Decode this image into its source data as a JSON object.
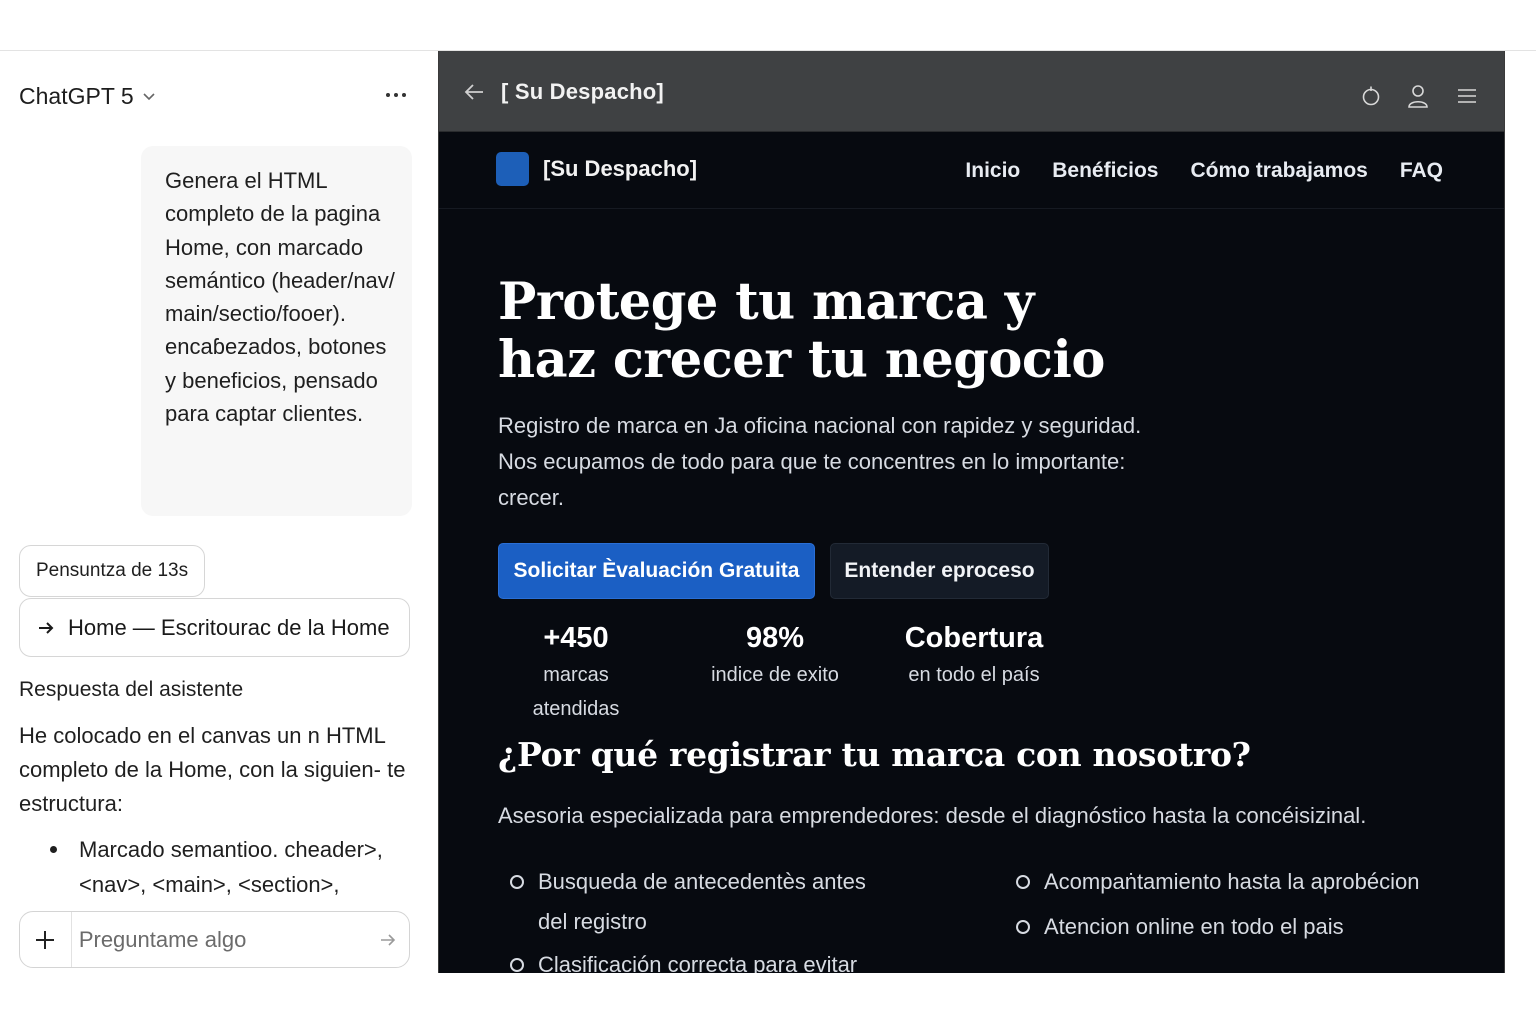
{
  "chat": {
    "model_name": "ChatGPT 5",
    "user_message": "Genera el HTML completo de la pagina Home, con marcado semántico (header/nav/ main/sectio/fooer). encaɓezados, botones y beneficios, pensado para captar clientes.",
    "thinking_label": "Pensuntza de 13s",
    "canvas_link": "Home — Escritourac de la Home",
    "response_label": "Respuesta del asistente",
    "response_text": "He colocado en el canvas un n HTML completo de la Home, con la siguien- te estructura:",
    "response_bullets": [
      "Marcado semantioo. cheader>, <nav>, <main>, <section>,"
    ],
    "composer_placeholder": "Preguntame algo"
  },
  "canvas": {
    "title": "[  Su Despacho]",
    "site": {
      "logo_text": "[Su Despacho]",
      "nav": [
        "Inicio",
        "Benéficios",
        "Cómo trabajamos",
        "FAQ"
      ],
      "hero_title_line1": "Protege tu marca y",
      "hero_title_line2": "haz crecer tu negocio",
      "hero_subtitle": "Registro de marca en Ja oficina nacional con rapidez y seguridad. Nos ecupamos de todo para que te concentres en lo importante: crecer.",
      "cta_primary": "Solicitar Èvaluación Gratuita",
      "cta_secondary": "Entender eproceso",
      "stats": [
        {
          "value": "+450",
          "label": "marcas atendidas"
        },
        {
          "value": "98%",
          "label": "indice de exito"
        },
        {
          "value": "Cobertura",
          "label": "en todo el país"
        }
      ],
      "why_title": "¿Por qué registrar tu marca con nosotro?",
      "why_subtitle": "Asesoria especializada para emprendedores: desde el diagnóstico hasta la concéisizinal.",
      "benefits": [
        "Busqueda de antecedentès antes del registro",
        "Clasificación correcta para evitar",
        "Acompaṅtamiento hasta la aprobécion",
        "Atencion online en todo el pais"
      ]
    }
  },
  "colors": {
    "canvas_bg": "#070a10",
    "canvas_bar": "#3f4143",
    "accent_blue": "#1b5fc4",
    "logo_blue": "#1d5fb8"
  }
}
